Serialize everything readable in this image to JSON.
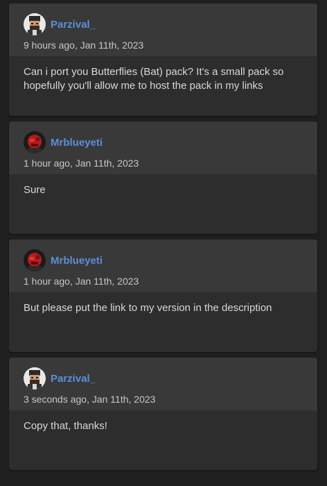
{
  "comments": [
    {
      "author": "Parzival_",
      "avatar_icon": "parzival-avatar-icon",
      "time": "9 hours ago, Jan 11th, 2023",
      "text": "Can i port you Butterflies (Bat) pack? It's a small pack so hopefully you'll allow me to host the pack in my links"
    },
    {
      "author": "Mrblueyeti",
      "avatar_icon": "mrblueyeti-avatar-icon",
      "time": "1 hour ago, Jan 11th, 2023",
      "text": "Sure"
    },
    {
      "author": "Mrblueyeti",
      "avatar_icon": "mrblueyeti-avatar-icon",
      "time": "1 hour ago, Jan 11th, 2023",
      "text": "But please put the link to my version in the description"
    },
    {
      "author": "Parzival_",
      "avatar_icon": "parzival-avatar-icon",
      "time": "3 seconds ago, Jan 11th, 2023",
      "text": "Copy that, thanks!"
    }
  ],
  "colors": {
    "username": "#5b8fd9",
    "card_header": "#393939",
    "card_body": "#2d2d2d",
    "page_background": "#1f1f1f"
  }
}
